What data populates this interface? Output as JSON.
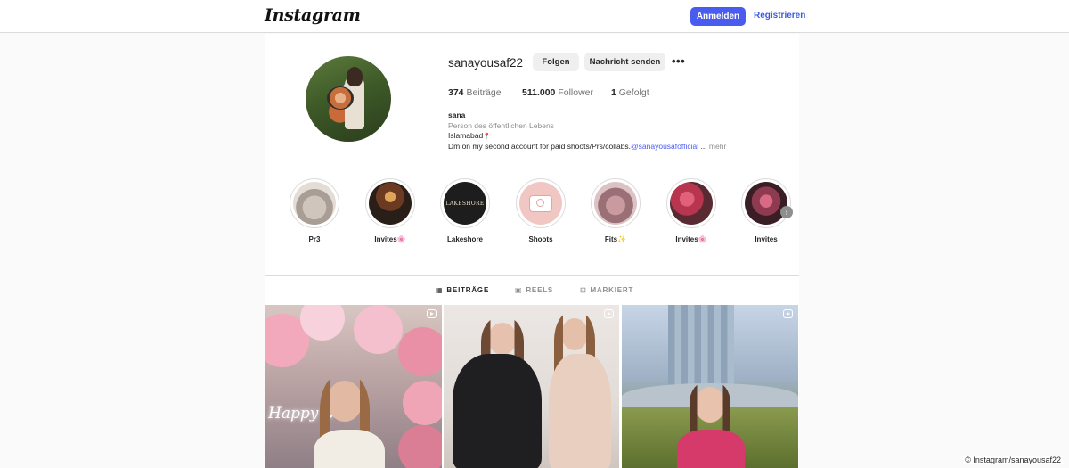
{
  "nav": {
    "logo": "Instagram",
    "login_label": "Anmelden",
    "register_label": "Registrieren",
    "accent_color": "#4a5cf0"
  },
  "profile": {
    "username": "sanayousaf22",
    "follow_label": "Folgen",
    "message_label": "Nachricht senden",
    "more_label": "•••",
    "stats": {
      "posts_count": "374",
      "posts_label": "Beiträge",
      "followers_count": "511.000",
      "followers_label": "Follower",
      "following_count": "1",
      "following_label": "Gefolgt"
    },
    "bio": {
      "name": "sana",
      "category": "Person des öffentlichen Lebens",
      "city": "Islamabad",
      "city_emoji": "📍",
      "text": "Dm on my second account for paid shoots/Prs/collabs.",
      "mention": "@sanayousafofficial",
      "ellipsis": " ... ",
      "more_label": "mehr"
    }
  },
  "highlights": [
    {
      "label": "Pr3",
      "icon": "highlight-pr3"
    },
    {
      "label": "Invites🌸",
      "icon": "highlight-invites"
    },
    {
      "label": "Lakeshore",
      "icon": "highlight-lakeshore",
      "logo_text": "LAKESHORE"
    },
    {
      "label": "Shoots",
      "icon": "highlight-shoots"
    },
    {
      "label": "Fits✨",
      "icon": "highlight-fits"
    },
    {
      "label": "Invites🌸",
      "icon": "highlight-invites"
    },
    {
      "label": "Invites",
      "icon": "highlight-invites"
    }
  ],
  "tabs": [
    {
      "label": "BEITRÄGE",
      "icon": "grid-icon",
      "active": true
    },
    {
      "label": "REELS",
      "icon": "reels-icon",
      "active": false
    },
    {
      "label": "MARKIERT",
      "icon": "tagged-icon",
      "active": false
    }
  ],
  "posts": [
    {
      "type": "reel",
      "overlay_text": "Happy B"
    },
    {
      "type": "reel"
    },
    {
      "type": "reel"
    }
  ],
  "credit": "© Instagram/sanayousaf22"
}
